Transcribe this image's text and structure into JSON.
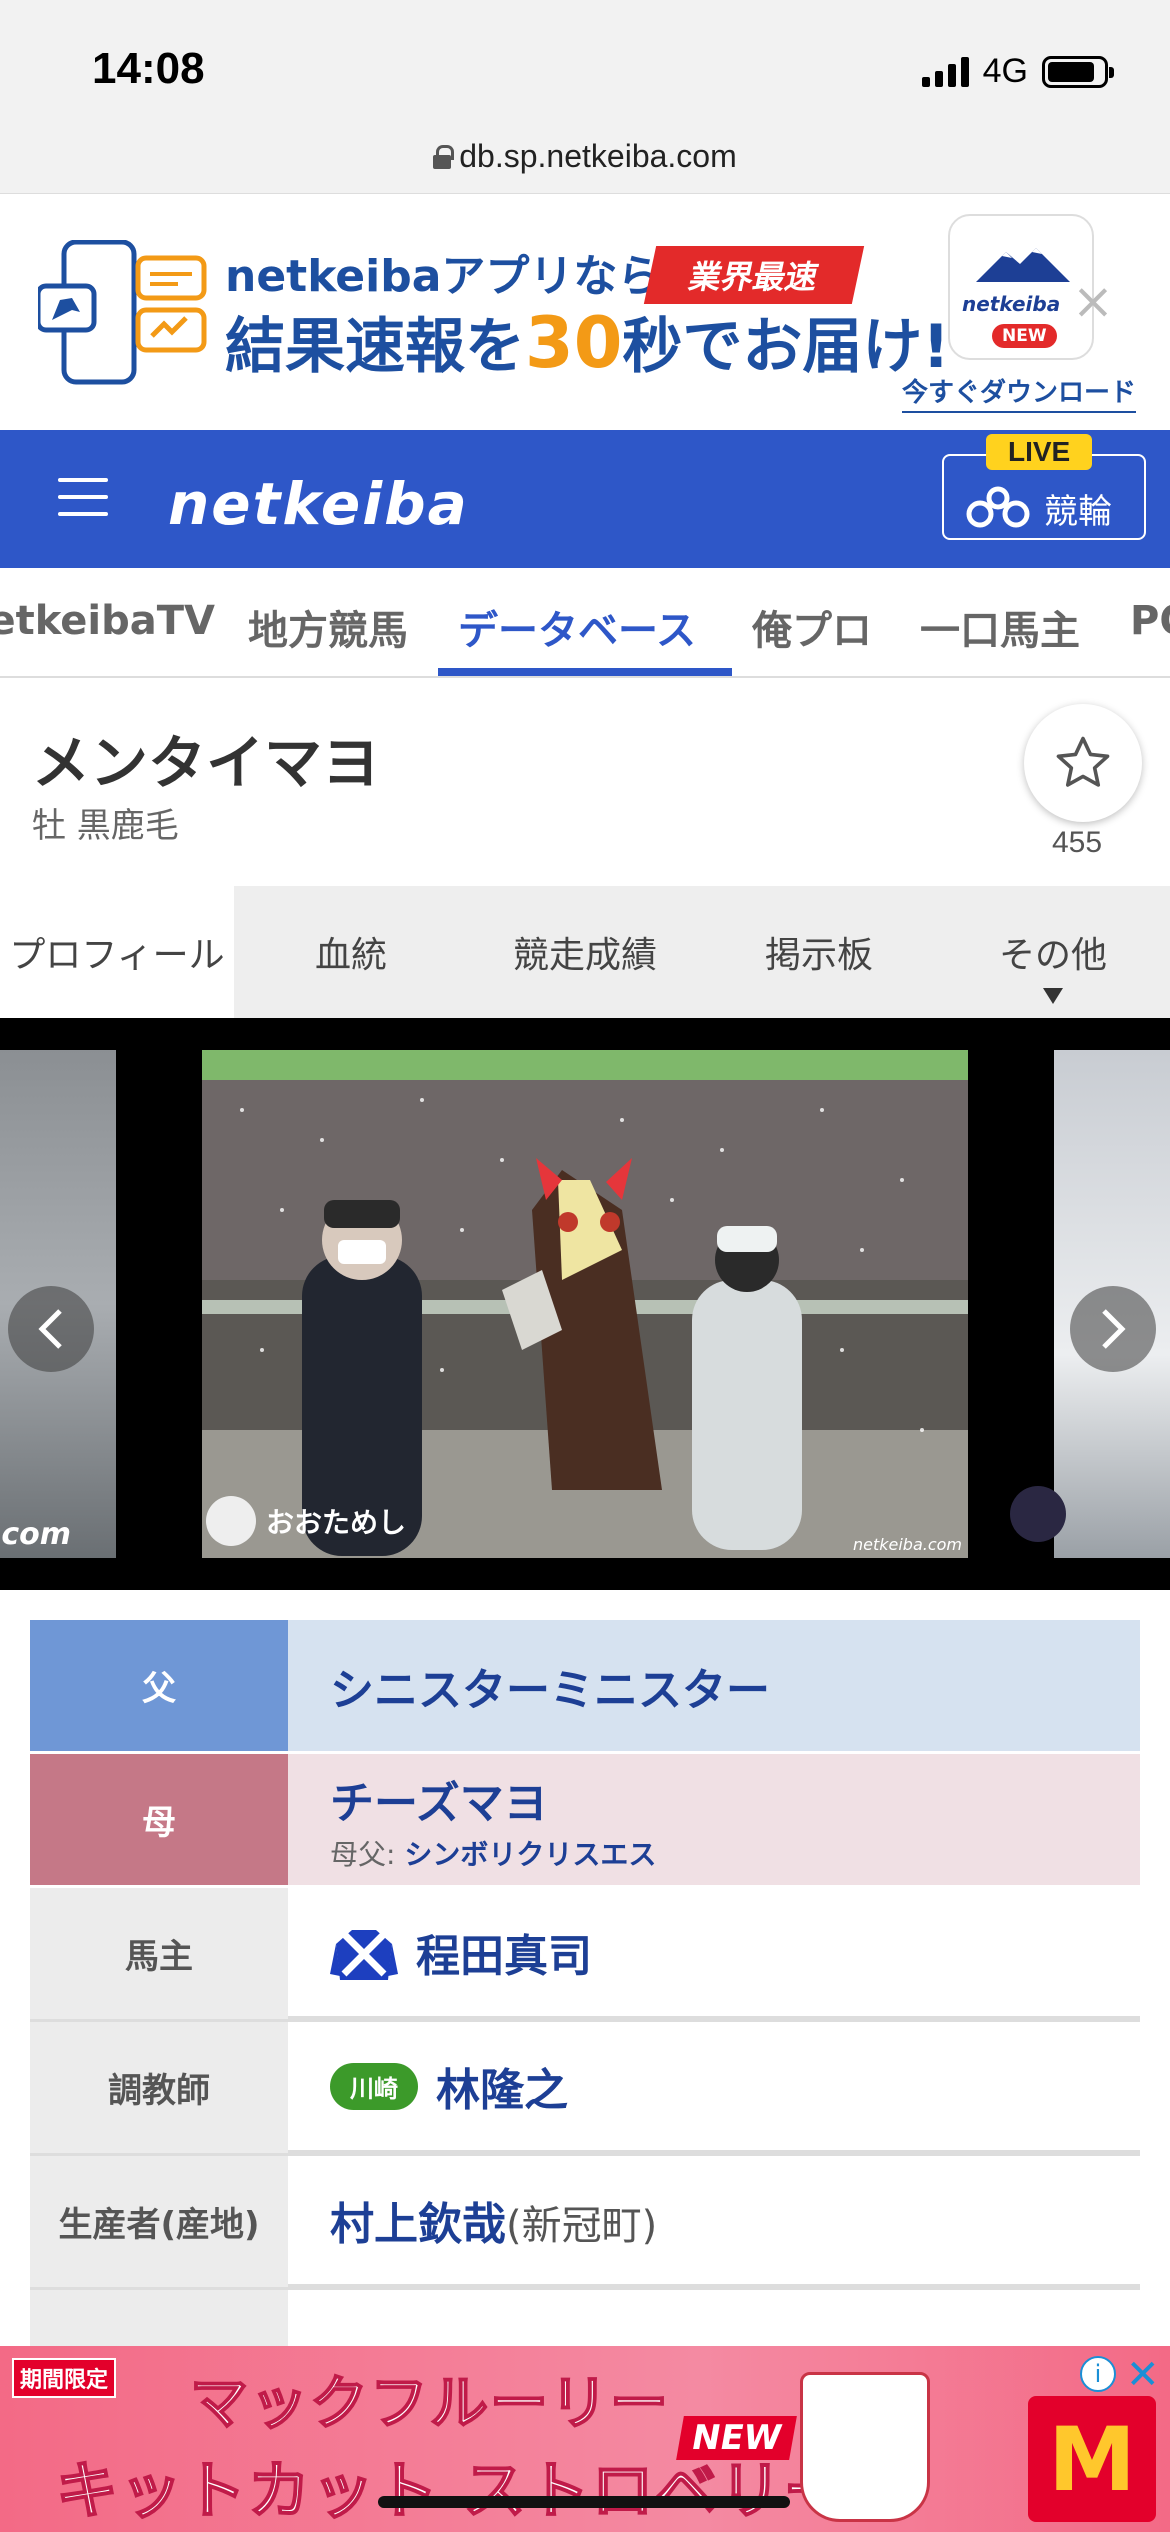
{
  "status": {
    "time": "14:08",
    "network": "4G",
    "url": "db.sp.netkeiba.com"
  },
  "app_banner": {
    "line1": "netkeibaアプリなら",
    "tag": "業界最速",
    "line2_pre": "結果速報を",
    "line2_num": "30",
    "line2_unit": "秒",
    "line2_post": "でお届け!",
    "logo_name": "netkeiba",
    "logo_new": "NEW",
    "close": "×",
    "download": "今すぐダウンロード"
  },
  "header": {
    "logo": "netkeiba",
    "live_badge": "LIVE",
    "live_label": "競輪"
  },
  "nav_tabs": [
    {
      "label": "netkeibaTV"
    },
    {
      "label": "地方競馬"
    },
    {
      "label": "データベース"
    },
    {
      "label": "俺プロ"
    },
    {
      "label": "一口馬主"
    },
    {
      "label": "PO"
    }
  ],
  "horse": {
    "name": "メンタイマヨ",
    "sub": "牡  黒鹿毛",
    "fav_count": "455"
  },
  "sub_tabs": [
    {
      "label": "プロフィール"
    },
    {
      "label": "血統"
    },
    {
      "label": "競走成績"
    },
    {
      "label": "掲示板"
    },
    {
      "label": "その他"
    }
  ],
  "gallery": {
    "caption": "おおためし",
    "prev_watermark": ".com",
    "main_watermark": "netkeiba.com"
  },
  "info": {
    "sire_label": "父",
    "sire": "シニスターミニスター",
    "dam_label": "母",
    "dam": "チーズマヨ",
    "damsire_label": "母父:",
    "damsire": "シンボリクリスエス",
    "owner_label": "馬主",
    "owner": "程田真司",
    "trainer_label": "調教師",
    "trainer_region": "川崎",
    "trainer": "林隆之",
    "breeder_label": "生産者(産地)",
    "breeder": "村上欽哉",
    "breeder_place": "(新冠町)"
  },
  "bottom_ad": {
    "badge": "期間限定",
    "line1": "マックフルーリー",
    "line2": "キットカット ストロベリー",
    "new": "NEW",
    "brand": "M",
    "info": "i",
    "close": "✕"
  },
  "colors": {
    "brand_blue": "#2e57c8",
    "sire_bg": "#d6e2f0",
    "dam_bg": "#f0e0e4",
    "region_green": "#3c9a2a"
  }
}
